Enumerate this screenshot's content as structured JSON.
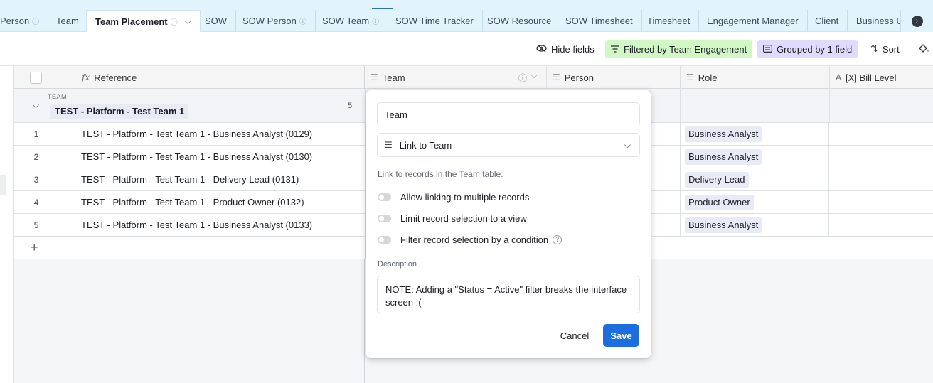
{
  "tabs": [
    {
      "label": "Person",
      "info": true
    },
    {
      "label": "Team",
      "info": false
    },
    {
      "label": "Team Placement",
      "info": true,
      "active": true
    },
    {
      "label": "SOW",
      "info": false
    },
    {
      "label": "SOW Person",
      "info": true
    },
    {
      "label": "SOW Team",
      "info": true
    },
    {
      "label": "SOW Time Tracker",
      "info": false
    },
    {
      "label": "SOW Resource",
      "info": false
    },
    {
      "label": "SOW Timesheet",
      "info": false
    },
    {
      "label": "Timesheet",
      "info": false
    },
    {
      "label": "Engagement Manager",
      "info": false
    },
    {
      "label": "Client",
      "info": false
    },
    {
      "label": "Business Ur",
      "info": false
    }
  ],
  "toolbar": {
    "hide_fields": "Hide fields",
    "filter": "Filtered by Team Engagement",
    "group": "Grouped by 1 field",
    "sort": "Sort"
  },
  "columns": {
    "reference": "Reference",
    "team": "Team",
    "person": "Person",
    "role": "Role",
    "bill_level": "[X] Bill Level"
  },
  "group": {
    "field_label": "TEAM",
    "value": "TEST - Platform - Test Team 1",
    "count": "5"
  },
  "rows": [
    {
      "num": "1",
      "reference": "TEST - Platform - Test Team 1 - Business Analyst (0129)",
      "role": "Business Analyst"
    },
    {
      "num": "2",
      "reference": "TEST - Platform - Test Team 1 - Business Analyst (0130)",
      "role": "Business Analyst"
    },
    {
      "num": "3",
      "reference": "TEST - Platform - Test Team 1 - Delivery Lead (0131)",
      "role": "Delivery Lead"
    },
    {
      "num": "4",
      "reference": "TEST - Platform - Test Team 1 - Product Owner (0132)",
      "role": "Product Owner"
    },
    {
      "num": "5",
      "reference": "TEST - Platform - Test Team 1 - Business Analyst (0133)",
      "role": "Business Analyst"
    }
  ],
  "popover": {
    "field_name": "Team",
    "field_type": "Link to Team",
    "type_description": "Link to records in the Team table.",
    "options": [
      {
        "label": "Allow linking to multiple records",
        "enabled": false
      },
      {
        "label": "Limit record selection to a view",
        "enabled": false
      },
      {
        "label": "Filter record selection by a condition",
        "enabled": false
      }
    ],
    "description_label": "Description",
    "description": "NOTE: Adding a \"Status = Active\" filter breaks the interface screen :(",
    "cancel": "Cancel",
    "save": "Save"
  },
  "colors": {
    "tabbar_bg": "#e2f4fb",
    "filter_bg": "#d1f7c4",
    "group_bg": "#e0dafd",
    "chip_bg": "#e8ebf6",
    "save_bg": "#1b6ee0"
  }
}
